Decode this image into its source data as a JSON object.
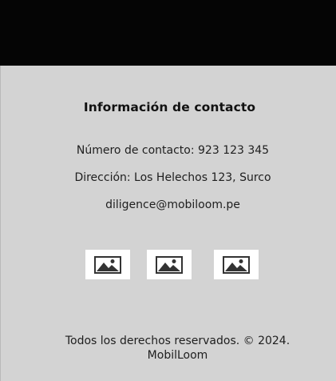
{
  "contact": {
    "title": "Información de contacto",
    "phone": "Número de contacto: 923 123 345",
    "address": "Dirección: Los Helechos 123, Surco",
    "email": "diligence@mobiloom.pe"
  },
  "images": [
    {
      "icon": "image-placeholder-icon"
    },
    {
      "icon": "image-placeholder-icon"
    },
    {
      "icon": "image-placeholder-icon"
    }
  ],
  "footer": {
    "copyright": "Todos los derechos reservados. © 2024. MobilLoom"
  },
  "colors": {
    "top_bar": "#050505",
    "background": "#d3d3d3",
    "image_box": "#ffffff",
    "icon": "#333333"
  }
}
